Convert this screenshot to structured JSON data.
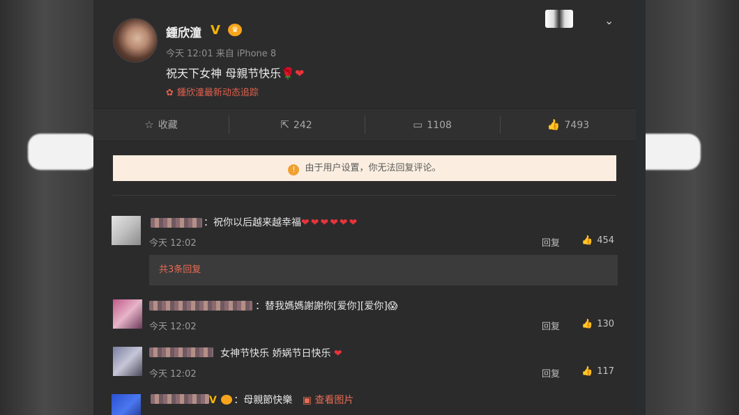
{
  "post": {
    "author": "鍾欣潼",
    "verified_badge": "V",
    "time": "今天 12:01",
    "source": "来自 iPhone 8",
    "text": "祝天下女神 母親节快乐",
    "emoji_rose": "🌹",
    "emoji_heart": "❤",
    "tracking_link": "鍾欣潼最新动态追踪",
    "chevron_icon": "chevron-down-icon"
  },
  "actions": {
    "favorite": {
      "label": "收藏",
      "icon": "star-icon"
    },
    "repost": {
      "label": "242",
      "icon": "share-icon"
    },
    "comment": {
      "label": "1108",
      "icon": "comment-icon"
    },
    "like": {
      "label": "7493",
      "icon": "thumbs-up-icon"
    }
  },
  "notice": "由于用户设置，你无法回复评论。",
  "comments": [
    {
      "text": "：祝你以后越来越幸福",
      "hearts": "❤❤❤❤❤❤",
      "time": "今天 12:02",
      "reply": "回复",
      "likes": "454"
    },
    {
      "text": "：替我媽媽謝謝你[爱你][爱你]",
      "time": "今天 12:02",
      "reply": "回复",
      "likes": "130"
    },
    {
      "text": "女神节快乐 娇娲节日快乐",
      "hearts": "❤",
      "time": "今天 12:02",
      "reply": "回复",
      "likes": "117"
    },
    {
      "text": "：母親節快樂",
      "view_image": "查看图片"
    }
  ],
  "more_replies": "共3条回复",
  "colors": {
    "panel_bg": "#2b2b2c",
    "accent_link": "#e0614c",
    "notice_bg": "#fbeee0",
    "heart": "#e8343a"
  }
}
